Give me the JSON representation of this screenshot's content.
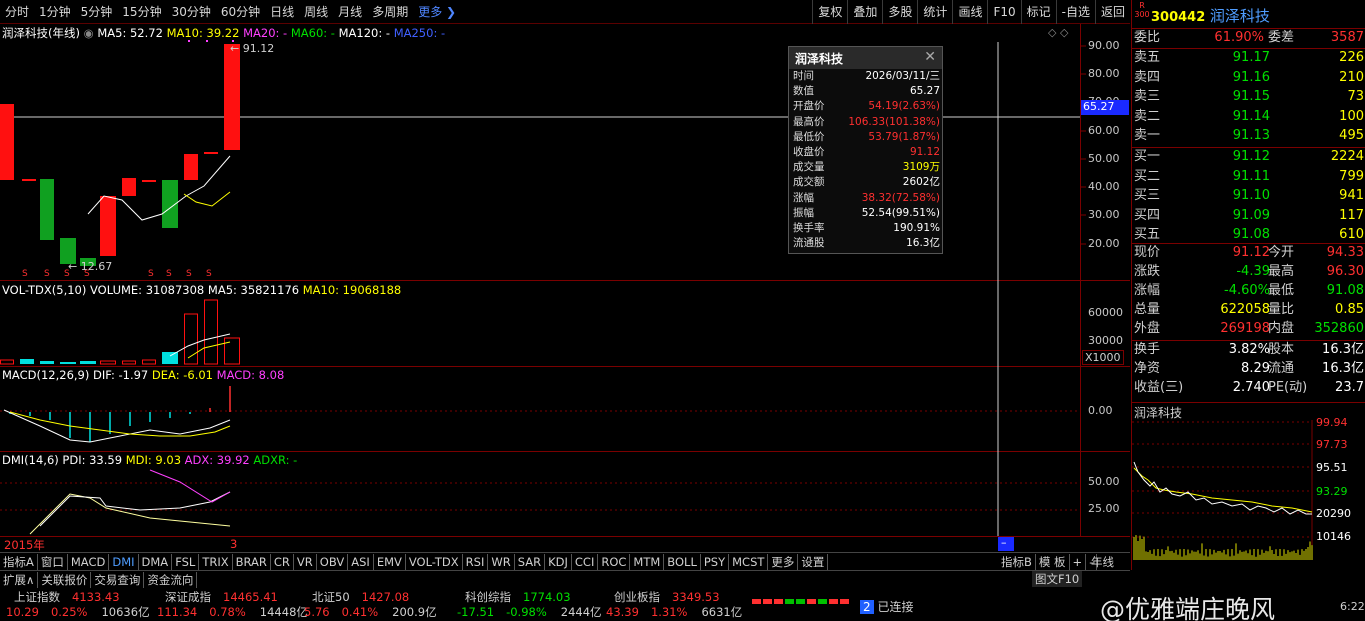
{
  "toolbar": {
    "periods": [
      "分时",
      "1分钟",
      "5分钟",
      "15分钟",
      "30分钟",
      "60分钟",
      "日线",
      "周线",
      "月线",
      "多周期"
    ],
    "more": "更多 ❯",
    "right": [
      "复权",
      "叠加",
      "多股",
      "统计",
      "画线",
      "F10",
      "标记",
      "-自选",
      "返回"
    ]
  },
  "kline_header": {
    "name": "润泽科技(年线)",
    "ma5": "MA5: 52.72",
    "ma10": "MA10: 39.22",
    "ma20": "MA20: -",
    "ma60": "MA60: -",
    "ma120": "MA120: -",
    "ma250": "MA250: -"
  },
  "price_labels": {
    "high": "91.12",
    "low": "12.67",
    "cursor": "65.27"
  },
  "price_axis": [
    "90.00",
    "80.00",
    "70.00",
    "60.00",
    "50.00",
    "40.00",
    "30.00",
    "20.00"
  ],
  "vol_header": {
    "name": "VOL-TDX(5,10)",
    "volume": "VOLUME: 31087308",
    "ma5": "MA5: 35821176",
    "ma10": "MA10: 19068188"
  },
  "vol_axis": [
    "60000",
    "30000"
  ],
  "vol_unit": "X1000",
  "macd_header": {
    "name": "MACD(12,26,9)",
    "dif": "DIF: -1.97",
    "dea": "DEA: -6.01",
    "macd": "MACD: 8.08"
  },
  "macd_axis": [
    "0.00"
  ],
  "dmi_header": {
    "name": "DMI(14,6)",
    "pdi": "PDI: 33.59",
    "mdi": "MDI: 9.03",
    "adx": "ADX: 39.92",
    "adxr": "ADXR: -"
  },
  "dmi_axis": [
    "50.00",
    "25.00"
  ],
  "date_label": "2015年",
  "date_end": "3",
  "popup": {
    "title": "润泽科技",
    "close": "✕",
    "rows": [
      {
        "k": "时间",
        "v": "2026/03/11/三",
        "c": "wht"
      },
      {
        "k": "数值",
        "v": "65.27",
        "c": "wht"
      },
      {
        "k": "开盘价",
        "v": "54.19(2.63%)",
        "c": "red"
      },
      {
        "k": "最高价",
        "v": "106.33(101.38%)",
        "c": "red"
      },
      {
        "k": "最低价",
        "v": "53.79(1.87%)",
        "c": "red"
      },
      {
        "k": "收盘价",
        "v": "91.12",
        "c": "red"
      },
      {
        "k": "成交量",
        "v": "3109万",
        "c": "yel"
      },
      {
        "k": "成交额",
        "v": "2602亿",
        "c": "wht"
      },
      {
        "k": "涨幅",
        "v": "38.32(72.58%)",
        "c": "red"
      },
      {
        "k": "振幅",
        "v": "52.54(99.51%)",
        "c": "wht"
      },
      {
        "k": "换手率",
        "v": "190.91%",
        "c": "wht"
      },
      {
        "k": "流通股",
        "v": "16.3亿",
        "c": "wht"
      }
    ]
  },
  "indicator_tabs": [
    "指标A",
    "窗口",
    "MACD",
    "DMI",
    "DMA",
    "FSL",
    "TRIX",
    "BRAR",
    "CR",
    "VR",
    "OBV",
    "ASI",
    "EMV",
    "VOL-TDX",
    "RSI",
    "WR",
    "SAR",
    "KDJ",
    "CCI",
    "ROC",
    "MTM",
    "BOLL",
    "PSY",
    "MCST",
    "更多",
    "设置"
  ],
  "indicator_right": [
    "指标B",
    "模 板",
    "+",
    "-"
  ],
  "period_label": "年线",
  "bottom_tabs": [
    "扩展∧",
    "关联报价",
    "交易查询",
    "资金流向"
  ],
  "quote": {
    "code": "300442",
    "name": "润泽科技",
    "badge_r": "R",
    "badge_num": "300",
    "weibi": {
      "label": "委比",
      "pct": "61.90%",
      "label2": "委差",
      "val": "3587"
    },
    "asks": [
      {
        "l": "卖五",
        "p": "91.17",
        "v": "226"
      },
      {
        "l": "卖四",
        "p": "91.16",
        "v": "210"
      },
      {
        "l": "卖三",
        "p": "91.15",
        "v": "73"
      },
      {
        "l": "卖二",
        "p": "91.14",
        "v": "100"
      },
      {
        "l": "卖一",
        "p": "91.13",
        "v": "495"
      }
    ],
    "bids": [
      {
        "l": "买一",
        "p": "91.12",
        "v": "2224"
      },
      {
        "l": "买二",
        "p": "91.11",
        "v": "799"
      },
      {
        "l": "买三",
        "p": "91.10",
        "v": "941"
      },
      {
        "l": "买四",
        "p": "91.09",
        "v": "117"
      },
      {
        "l": "买五",
        "p": "91.08",
        "v": "610"
      }
    ],
    "stats": [
      {
        "a": "现价",
        "b": "91.12",
        "bc": "red",
        "d": "今开",
        "c": "94.33",
        "cc": "red"
      },
      {
        "a": "涨跌",
        "b": "-4.39",
        "bc": "grn",
        "d": "最高",
        "c": "96.30",
        "cc": "red"
      },
      {
        "a": "涨幅",
        "b": "-4.60%",
        "bc": "grn",
        "d": "最低",
        "c": "91.08",
        "cc": "grn"
      },
      {
        "a": "总量",
        "b": "622058",
        "bc": "yel",
        "d": "量比",
        "c": "0.85",
        "cc": "yel"
      },
      {
        "a": "外盘",
        "b": "269198",
        "bc": "red",
        "d": "内盘",
        "c": "352860",
        "cc": "grn"
      }
    ],
    "stats2": [
      {
        "a": "换手",
        "b": "3.82%",
        "d": "股本",
        "c": "16.3亿"
      },
      {
        "a": "净资",
        "b": "8.29",
        "d": "流通",
        "c": "16.3亿"
      },
      {
        "a": "收益(三)",
        "b": "2.740",
        "d": "PE(动)",
        "c": "23.7"
      }
    ],
    "mini_title": "润泽科技",
    "mini_axis": [
      "99.94",
      "97.73",
      "95.51",
      "93.29",
      "20290",
      "10146"
    ]
  },
  "mini_tabs": [
    "图文F10",
    "…"
  ],
  "index_bar": [
    {
      "name": "上证指数",
      "val": "4133.43",
      "chg": "10.29",
      "pct": "0.25%",
      "amt": "10636亿",
      "cls": "red"
    },
    {
      "name": "深证成指",
      "val": "14465.41",
      "chg": "111.34",
      "pct": "0.78%",
      "amt": "14448亿",
      "cls": "red"
    },
    {
      "name": "北证50",
      "val": "1427.08",
      "chg": "5.76",
      "pct": "0.41%",
      "amt": "200.9亿",
      "cls": "red"
    },
    {
      "name": "科创综指",
      "val": "1774.03",
      "chg": "-17.51",
      "pct": "-0.98%",
      "amt": "2444亿",
      "cls": "grn"
    },
    {
      "name": "创业板指",
      "val": "3349.53",
      "chg": "43.39",
      "pct": "1.31%",
      "amt": "6631亿",
      "cls": "red"
    }
  ],
  "connection": {
    "num": "2",
    "text": "已连接"
  },
  "watermark": "@优雅端庄晚风",
  "time": "6:22"
}
